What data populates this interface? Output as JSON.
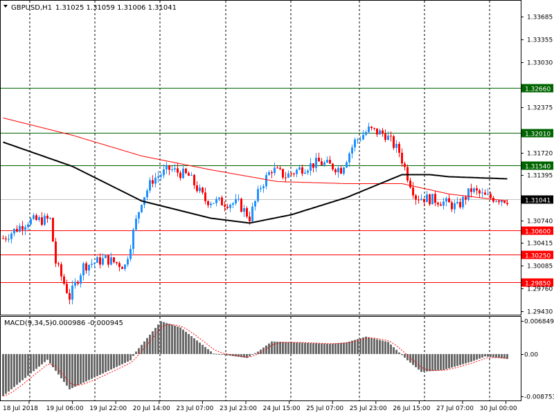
{
  "header": {
    "symbol": "GBPUSD,H1",
    "ohlc": "1.31025 1.31059 1.31006 1.31041"
  },
  "macd_header": {
    "label": "MACD(9,34,5)",
    "values": "-0.000986 -0.000945"
  },
  "colors": {
    "bull": "#1e90ff",
    "bear": "#ff0000",
    "ma_slow": "#000000",
    "ma_fast": "#ff0000",
    "support": "#ff0000",
    "resistance": "#006400",
    "current": "#c0c0c0",
    "histogram": "#696969"
  },
  "chart_data": {
    "type": "candlestick",
    "title": "GBPUSD,H1",
    "bar_count": 183,
    "price_axis": {
      "range": [
        1.2943,
        1.33685
      ],
      "ticks": [
        "1.33685",
        "1.33355",
        "1.33030",
        "1.32375",
        "1.31720",
        "1.31395",
        "1.30740",
        "1.30415",
        "1.30085",
        "1.29760",
        "1.29430"
      ]
    },
    "time_axis": {
      "labels": [
        "18 Jul 2018",
        "19 Jul 06:00",
        "19 Jul 22:00",
        "20 Jul 14:00",
        "23 Jul 07:00",
        "23 Jul 23:00",
        "24 Jul 15:00",
        "25 Jul 07:00",
        "25 Jul 23:00",
        "26 Jul 15:00",
        "27 Jul 07:00",
        "30 Jul 00:00"
      ]
    },
    "close_keypoints": [
      [
        0,
        1.3048
      ],
      [
        9,
        1.3073
      ],
      [
        17,
        1.3075
      ],
      [
        19,
        1.3013
      ],
      [
        24,
        1.2963
      ],
      [
        29,
        1.3008
      ],
      [
        37,
        1.3018
      ],
      [
        44,
        1.3008
      ],
      [
        48,
        1.3073
      ],
      [
        50,
        1.3103
      ],
      [
        54,
        1.3133
      ],
      [
        60,
        1.3148
      ],
      [
        67,
        1.3138
      ],
      [
        73,
        1.3103
      ],
      [
        79,
        1.31
      ],
      [
        85,
        1.3098
      ],
      [
        89,
        1.3078
      ],
      [
        93,
        1.3123
      ],
      [
        97,
        1.3148
      ],
      [
        102,
        1.3138
      ],
      [
        107,
        1.3148
      ],
      [
        114,
        1.3158
      ],
      [
        122,
        1.3148
      ],
      [
        127,
        1.3188
      ],
      [
        132,
        1.3205
      ],
      [
        138,
        1.3198
      ],
      [
        143,
        1.3173
      ],
      [
        146,
        1.3138
      ],
      [
        149,
        1.3108
      ],
      [
        157,
        1.3103
      ],
      [
        164,
        1.3093
      ],
      [
        169,
        1.3118
      ],
      [
        174,
        1.3108
      ],
      [
        182,
        1.3104
      ]
    ],
    "levels": [
      {
        "price": "1.32660",
        "type": "resistance"
      },
      {
        "price": "1.32010",
        "type": "resistance"
      },
      {
        "price": "1.31540",
        "type": "resistance"
      },
      {
        "price": "1.31041",
        "type": "current"
      },
      {
        "price": "1.30600",
        "type": "support"
      },
      {
        "price": "1.30250",
        "type": "support"
      },
      {
        "price": "1.29850",
        "type": "support"
      }
    ],
    "ma_slow_keypoints": [
      [
        0,
        1.3187
      ],
      [
        25,
        1.3152
      ],
      [
        50,
        1.3102
      ],
      [
        75,
        1.3077
      ],
      [
        89,
        1.307
      ],
      [
        104,
        1.3082
      ],
      [
        124,
        1.3107
      ],
      [
        144,
        1.314
      ],
      [
        154,
        1.314
      ],
      [
        161,
        1.3137
      ],
      [
        182,
        1.3134
      ]
    ],
    "ma_fast_keypoints": [
      [
        0,
        1.3222
      ],
      [
        25,
        1.3197
      ],
      [
        50,
        1.3167
      ],
      [
        75,
        1.3147
      ],
      [
        99,
        1.313
      ],
      [
        124,
        1.3127
      ],
      [
        144,
        1.3127
      ],
      [
        161,
        1.3112
      ],
      [
        182,
        1.3102
      ]
    ],
    "macd": {
      "range": [
        -0.008753,
        0.006849
      ],
      "ticks": [
        "0.006849",
        "0.00",
        "-0.008753"
      ],
      "hist_keypoints": [
        [
          0,
          -0.0087
        ],
        [
          16,
          -0.0012
        ],
        [
          24,
          -0.0073
        ],
        [
          46,
          -0.0013
        ],
        [
          48,
          0.0005
        ],
        [
          57,
          0.0068
        ],
        [
          64,
          0.0055
        ],
        [
          76,
          0.0001
        ],
        [
          88,
          -0.0008
        ],
        [
          92,
          0.0005
        ],
        [
          97,
          0.0026
        ],
        [
          118,
          0.0021
        ],
        [
          124,
          0.0024
        ],
        [
          131,
          0.0036
        ],
        [
          139,
          0.0025
        ],
        [
          146,
          -0.0013
        ],
        [
          151,
          -0.0037
        ],
        [
          159,
          -0.0033
        ],
        [
          169,
          -0.0016
        ],
        [
          174,
          -0.0005
        ],
        [
          182,
          -0.001
        ]
      ],
      "signal_lag": 3
    }
  }
}
